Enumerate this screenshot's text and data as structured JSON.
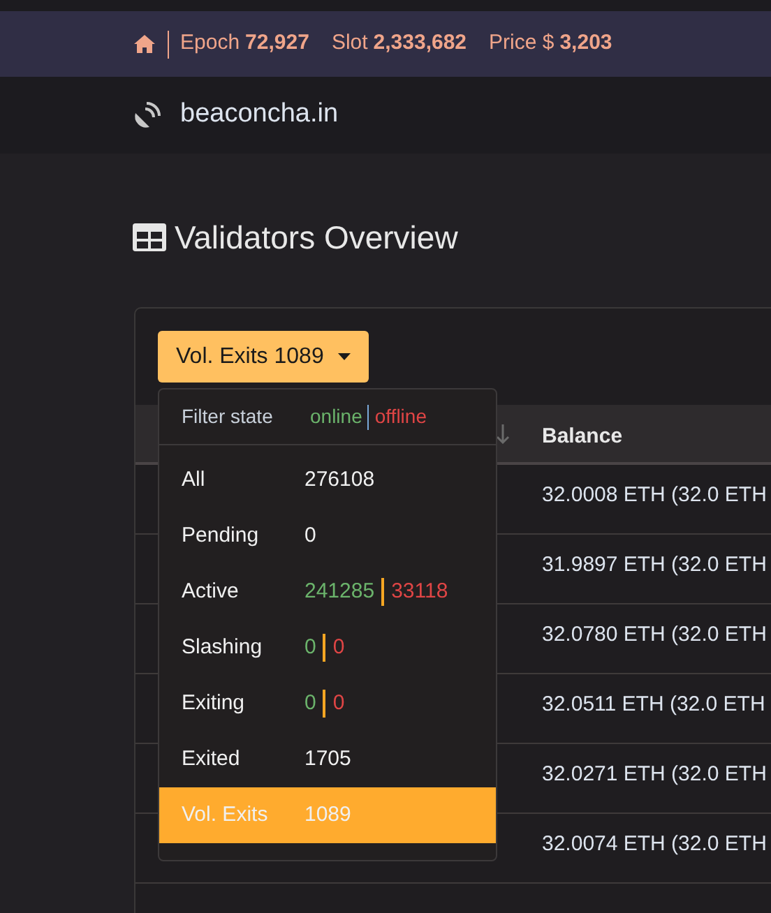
{
  "top_bar": {
    "epoch_label": "Epoch",
    "epoch": "72,927",
    "slot_label": "Slot",
    "slot": "2,333,682",
    "price_label": "Price $",
    "price": "3,203"
  },
  "navbar": {
    "brand": "beaconcha.in"
  },
  "heading": "Validators Overview",
  "filter_button": {
    "label": "Vol. Exits 1089"
  },
  "dropdown": {
    "title": "Filter state",
    "online": "online",
    "offline": "offline",
    "items": [
      {
        "kind": "single",
        "label": "All",
        "value": "276108",
        "selected": false
      },
      {
        "kind": "single",
        "label": "Pending",
        "value": "0",
        "selected": false
      },
      {
        "kind": "split",
        "label": "Active",
        "online": "241285",
        "offline": "33118",
        "selected": false
      },
      {
        "kind": "split",
        "label": "Slashing",
        "online": "0",
        "offline": "0",
        "selected": false
      },
      {
        "kind": "split",
        "label": "Exiting",
        "online": "0",
        "offline": "0",
        "selected": false
      },
      {
        "kind": "single",
        "label": "Exited",
        "value": "1705",
        "selected": false
      },
      {
        "kind": "single",
        "label": "Vol. Exits",
        "value": "1089",
        "selected": true
      }
    ]
  },
  "table": {
    "columns": [
      "Balance"
    ],
    "rows": [
      {
        "balance": "32.0008 ETH (32.0 ETH"
      },
      {
        "balance": "31.9897 ETH (32.0 ETH"
      },
      {
        "balance": "32.0780 ETH (32.0 ETH"
      },
      {
        "balance": "32.0511 ETH (32.0 ETH"
      },
      {
        "balance": "32.0271 ETH (32.0 ETH"
      },
      {
        "balance": "32.0074 ETH (32.0 ETH"
      }
    ]
  }
}
